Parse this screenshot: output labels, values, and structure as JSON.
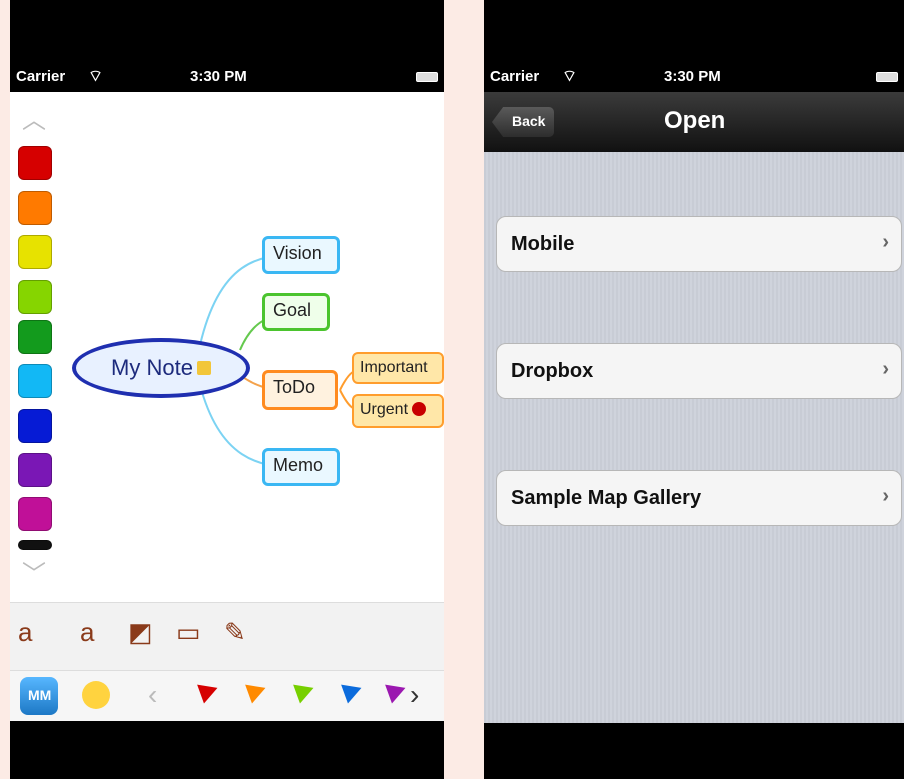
{
  "left": {
    "status": {
      "carrier": "Carrier",
      "time": "3:30 PM"
    },
    "map": {
      "central": "My Note",
      "nodes": {
        "vision": "Vision",
        "goal": "Goal",
        "todo": "ToDo",
        "important": "Important",
        "urgent": "Urgent",
        "memo": "Memo"
      },
      "colors": {
        "vision": "#9ee1ff",
        "goal": "#a6f07e",
        "todo": "#ffb25b",
        "subnode": "#ffd890",
        "memo": "#a6e8ff"
      }
    },
    "palette": [
      "#d60000",
      "#ff7a00",
      "#e7e200",
      "#86d500",
      "#139b1d",
      "#12b8f5",
      "#061bd5",
      "#7a17b5",
      "#c01098",
      "#111111"
    ],
    "flags": [
      "#d60000",
      "#ff8a00",
      "#77d000",
      "#0b6bdc",
      "#9b18b0"
    ],
    "logo_text": "MM"
  },
  "right": {
    "status": {
      "carrier": "Carrier",
      "time": "3:30 PM"
    },
    "nav": {
      "back": "Back",
      "title": "Open"
    },
    "items": [
      "Mobile",
      "Dropbox",
      "Sample Map Gallery"
    ]
  }
}
